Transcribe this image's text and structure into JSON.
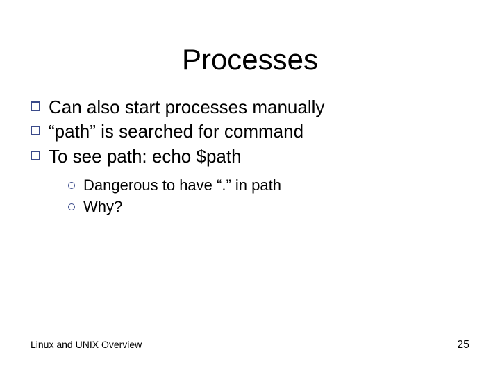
{
  "title": "Processes",
  "bullets": [
    "Can also start processes manually",
    "“path” is searched for command",
    "To see path:  echo $path"
  ],
  "subbullets": [
    "Dangerous to have “.” in path",
    "Why?"
  ],
  "footer": {
    "left": "Linux and UNIX Overview",
    "page": "25"
  }
}
